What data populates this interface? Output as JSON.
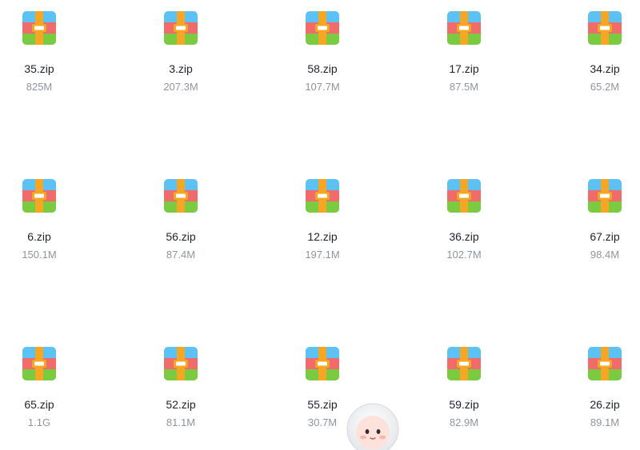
{
  "files": [
    {
      "name": "35.zip",
      "size": "825M"
    },
    {
      "name": "3.zip",
      "size": "207.3M"
    },
    {
      "name": "58.zip",
      "size": "107.7M"
    },
    {
      "name": "17.zip",
      "size": "87.5M"
    },
    {
      "name": "34.zip",
      "size": "65.2M"
    },
    {
      "name": "6.zip",
      "size": "150.1M"
    },
    {
      "name": "56.zip",
      "size": "87.4M"
    },
    {
      "name": "12.zip",
      "size": "197.1M"
    },
    {
      "name": "36.zip",
      "size": "102.7M"
    },
    {
      "name": "67.zip",
      "size": "98.4M"
    },
    {
      "name": "65.zip",
      "size": "1.1G"
    },
    {
      "name": "52.zip",
      "size": "81.1M"
    },
    {
      "name": "55.zip",
      "size": "30.7M"
    },
    {
      "name": "59.zip",
      "size": "82.9M"
    },
    {
      "name": "26.zip",
      "size": "89.1M"
    }
  ],
  "icons": {
    "file": "zip-archive-icon",
    "assistant": "assistant-mascot-icon"
  },
  "colors": {
    "name_text": "#1f2329",
    "size_text": "#8f959e",
    "zip_top": "#5bc2f3",
    "zip_middle": "#f26b6b",
    "zip_bottom": "#7acb3f",
    "zip_strap": "#f5a623"
  }
}
